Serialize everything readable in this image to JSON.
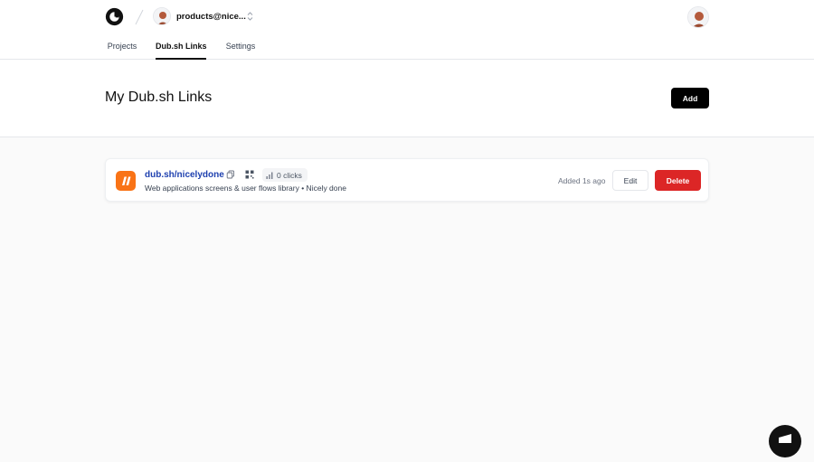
{
  "header": {
    "account_label": "products@nice...",
    "icons": {
      "logo": "dub-logo-icon",
      "account_avatar": "avatar-icon",
      "chevron": "chevron-up-down-icon",
      "user_avatar": "avatar-icon"
    }
  },
  "tabs": [
    {
      "label": "Projects",
      "active": false
    },
    {
      "label": "Dub.sh Links",
      "active": true
    },
    {
      "label": "Settings",
      "active": false
    }
  ],
  "hero": {
    "title": "My Dub.sh Links",
    "add_label": "Add"
  },
  "links": [
    {
      "short_url": "dub.sh/nicelydone",
      "clicks_label": "0 clicks",
      "description": "Web applications screens & user flows library • Nicely done",
      "added_label": "Added 1s ago",
      "edit_label": "Edit",
      "delete_label": "Delete"
    }
  ],
  "colors": {
    "accent_link": "#1e40af",
    "danger": "#dc2626",
    "primary_button": "#000000",
    "favicon": "#f97316"
  }
}
